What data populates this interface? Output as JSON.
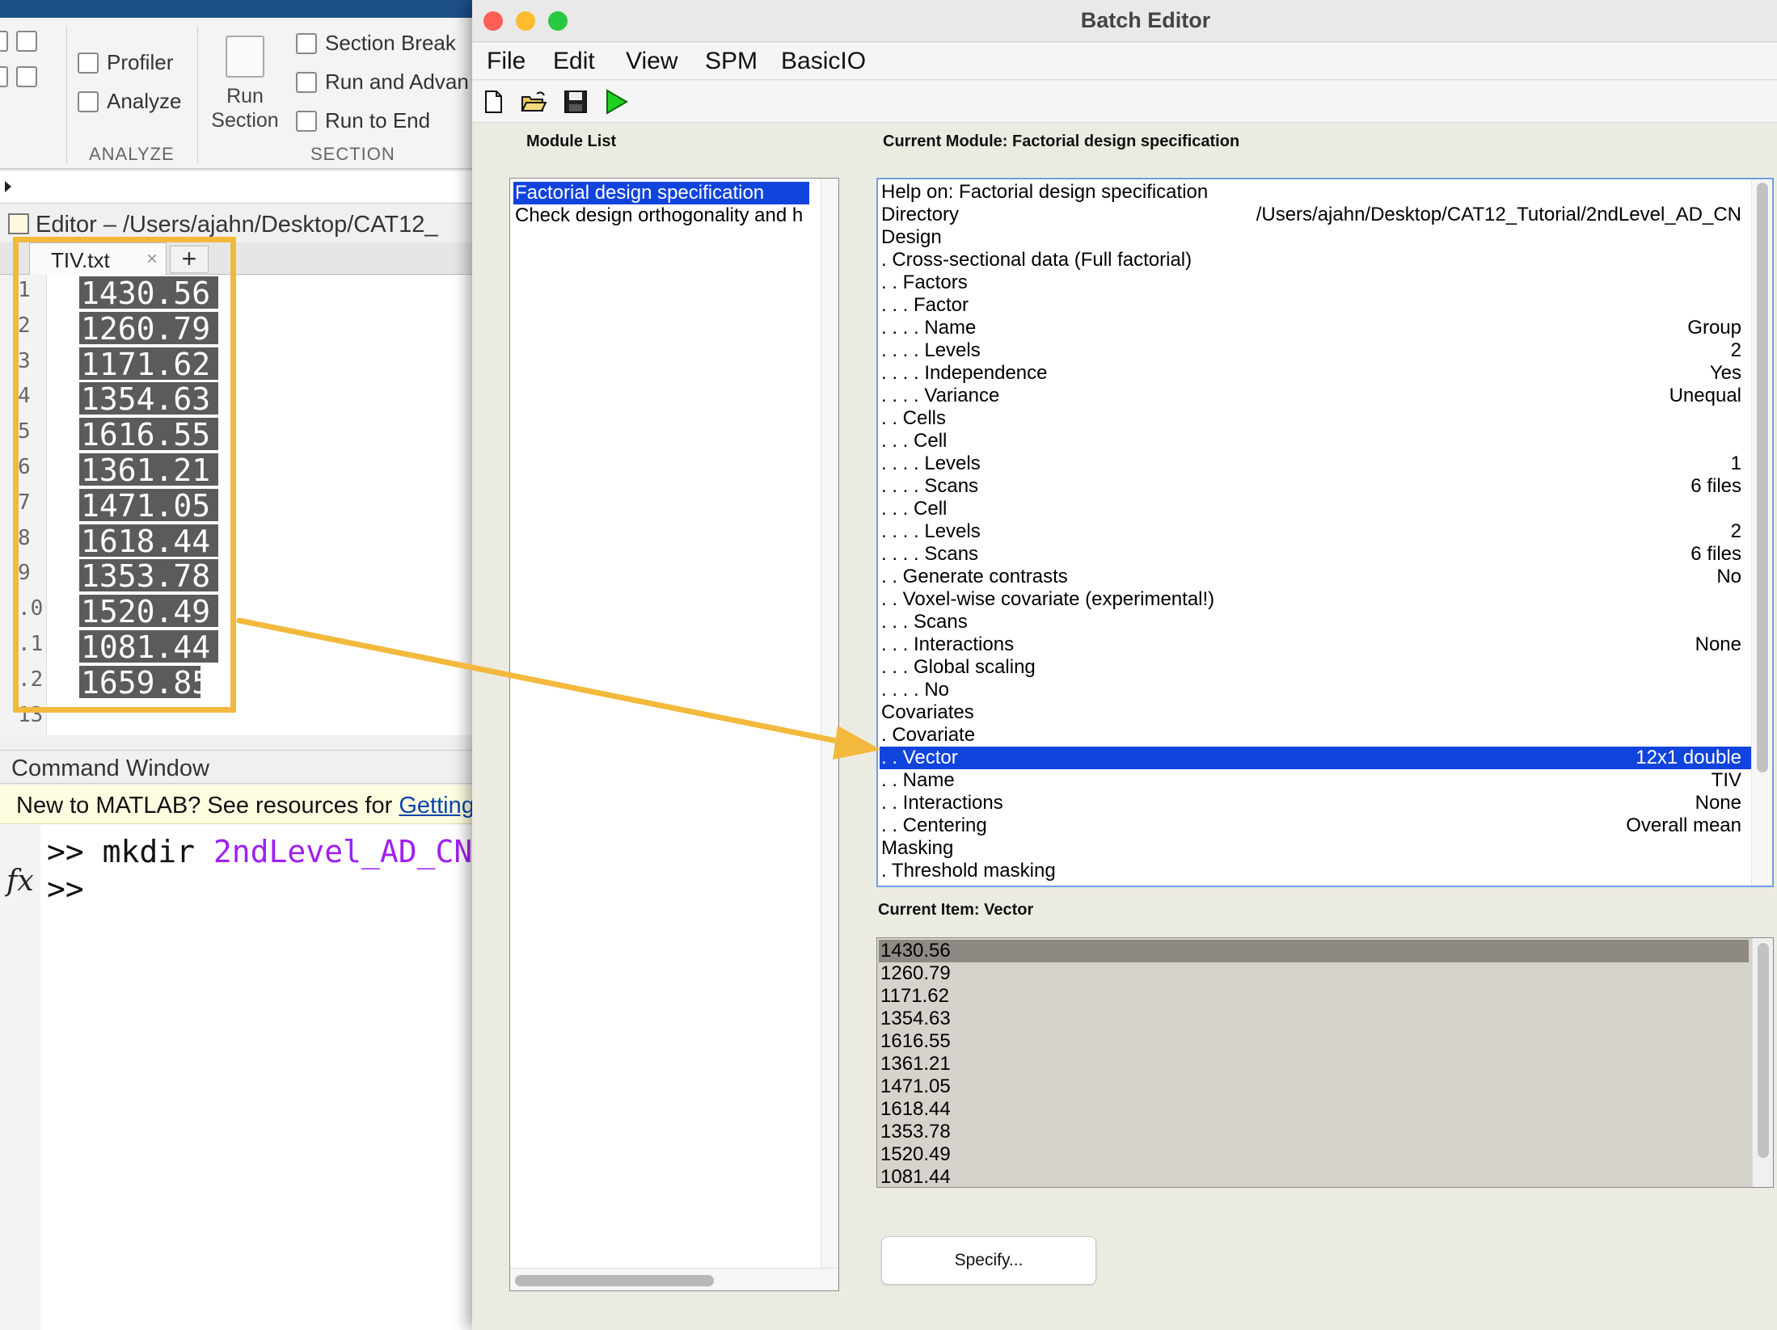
{
  "matlab": {
    "ribbon": {
      "profiler": "Profiler",
      "analyze": "Analyze",
      "analyze_section": "ANALYZE",
      "run_section": "Run\nSection",
      "section_break": "Section Break",
      "run_and_advance": "Run and Advan",
      "run_to_end": "Run to End",
      "section_section": "SECTION"
    },
    "editor_title": "Editor – /Users/ajahn/Desktop/CAT12_",
    "tab": {
      "label": "TIV.txt",
      "close": "×",
      "add": "+"
    },
    "line_numbers": [
      "1",
      "2",
      "3",
      "4",
      "5",
      "6",
      "7",
      "8",
      "9",
      ".0",
      ".1",
      ".2",
      "13"
    ],
    "lines": [
      "1430.56",
      "1260.79",
      "1171.62",
      "1354.63",
      "1616.55",
      "1361.21",
      "1471.05",
      "1618.44",
      "1353.78",
      "1520.49",
      "1081.44",
      "1659.85"
    ],
    "command_window": {
      "header": "Command Window",
      "banner_text": "New to MATLAB? See resources for ",
      "banner_link": "Getting St",
      "prompt1": ">> ",
      "cmd1": "mkdir ",
      "arg1": "2ndLevel_AD_CN",
      "prompt2": ">>",
      "fx": "fx"
    }
  },
  "batch_editor": {
    "title": "Batch Editor",
    "menus": [
      "File",
      "Edit",
      "View",
      "SPM",
      "BasicIO"
    ],
    "toolbar_icons": [
      "new-file-icon",
      "open-folder-icon",
      "save-icon",
      "run-icon"
    ],
    "module_list_label": "Module List",
    "modules": [
      {
        "label": "Factorial design specification",
        "selected": true
      },
      {
        "label": "Check design orthogonality and h",
        "selected": false
      }
    ],
    "current_module_label": "Current Module: Factorial design specification",
    "rows": [
      {
        "label": "Help on: Factorial design specification",
        "value": ""
      },
      {
        "label": "Directory",
        "value": "/Users/ajahn/Desktop/CAT12_Tutorial/2ndLevel_AD_CN"
      },
      {
        "label": "Design",
        "value": ""
      },
      {
        "label": ". Cross-sectional data (Full factorial)",
        "value": ""
      },
      {
        "label": ". . Factors",
        "value": ""
      },
      {
        "label": ". . . Factor",
        "value": ""
      },
      {
        "label": ". . . . Name",
        "value": "Group"
      },
      {
        "label": ". . . . Levels",
        "value": "2"
      },
      {
        "label": ". . . . Independence",
        "value": "Yes"
      },
      {
        "label": ". . . . Variance",
        "value": "Unequal"
      },
      {
        "label": ". . Cells",
        "value": ""
      },
      {
        "label": ". . . Cell",
        "value": ""
      },
      {
        "label": ". . . . Levels",
        "value": "1"
      },
      {
        "label": ". . . . Scans",
        "value": "6 files"
      },
      {
        "label": ". . . Cell",
        "value": ""
      },
      {
        "label": ". . . . Levels",
        "value": "2"
      },
      {
        "label": ". . . . Scans",
        "value": "6 files"
      },
      {
        "label": ". . Generate contrasts",
        "value": "No"
      },
      {
        "label": ". . Voxel-wise covariate (experimental!)",
        "value": ""
      },
      {
        "label": ". . . Scans",
        "value": ""
      },
      {
        "label": ". . . Interactions",
        "value": "None"
      },
      {
        "label": ". . . Global scaling",
        "value": ""
      },
      {
        "label": ". . . . No",
        "value": ""
      },
      {
        "label": "Covariates",
        "value": ""
      },
      {
        "label": ". Covariate",
        "value": ""
      },
      {
        "label": ". . Vector",
        "value": "12x1 double",
        "selected": true
      },
      {
        "label": ". . Name",
        "value": "TIV"
      },
      {
        "label": ". . Interactions",
        "value": "None"
      },
      {
        "label": ". . Centering",
        "value": "Overall mean"
      },
      {
        "label": "Masking",
        "value": ""
      },
      {
        "label": ". Threshold masking",
        "value": ""
      }
    ],
    "current_item_label": "Current Item: Vector",
    "item_values": [
      "1430.56",
      "1260.79",
      "1171.62",
      "1354.63",
      "1616.55",
      "1361.21",
      "1471.05",
      "1618.44",
      "1353.78",
      "1520.49",
      "1081.44"
    ],
    "specify_button": "Specify..."
  },
  "colors": {
    "highlight_annotation": "#f3b93c",
    "selection_blue": "#1144dd",
    "matlab_string_purple": "#a020f0"
  }
}
